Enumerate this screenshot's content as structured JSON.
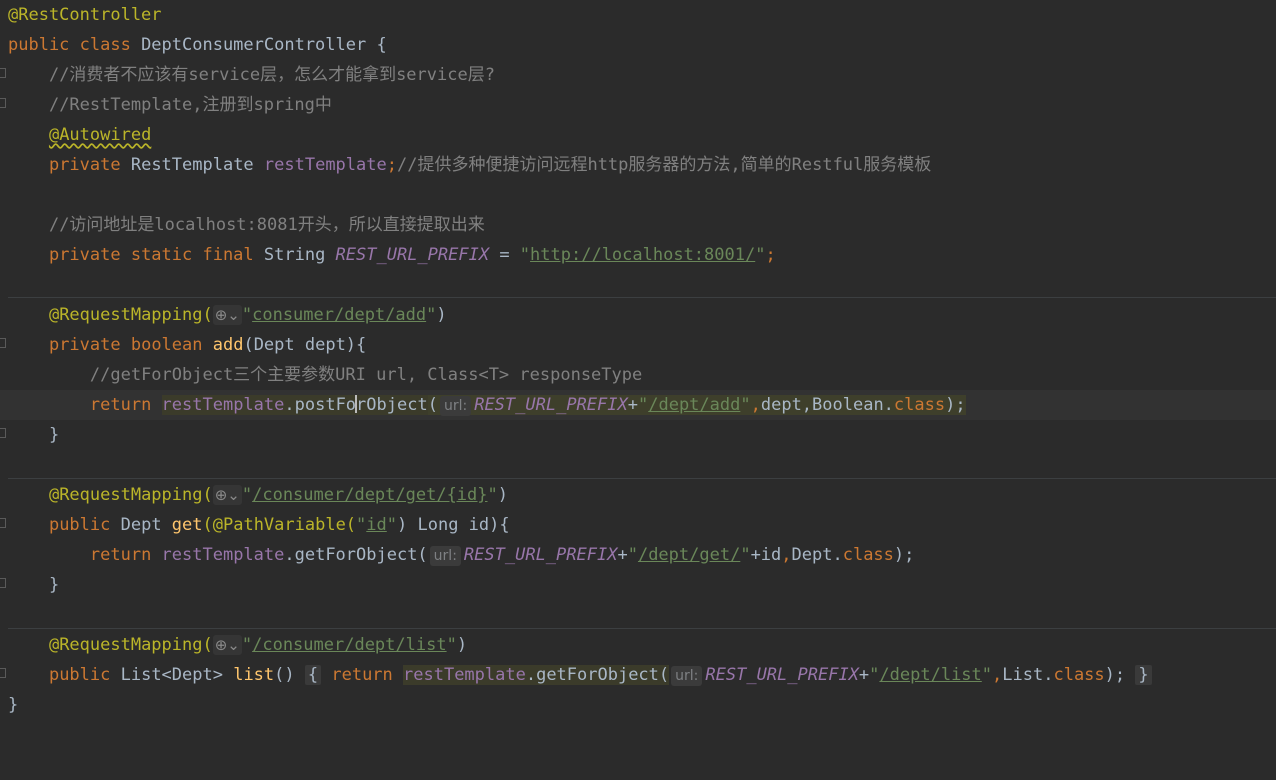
{
  "editor": {
    "line1": {
      "ann": "@RestController"
    },
    "line2": {
      "kw": "public class",
      "name": " DeptConsumerController {"
    },
    "line3": {
      "comment": "//消费者不应该有service层，怎么才能拿到service层?"
    },
    "line4": {
      "comment": "//RestTemplate,注册到spring中"
    },
    "line5": {
      "ann": "@Autowired"
    },
    "line6": {
      "kw": "private",
      "type": " RestTemplate ",
      "field": "restTemplate",
      "semi": ";",
      "comment": "//提供多种便捷访问远程http服务器的方法,简单的Restful服务模板"
    },
    "line8": {
      "comment": "//访问地址是localhost:8081开头，所以直接提取出来"
    },
    "line9": {
      "kw": "private static final",
      "type": " String ",
      "const": "REST_URL_PREFIX",
      "eq": " = ",
      "q1": "\"",
      "url": "http://localhost:8001/",
      "q2": "\"",
      "semi": ";"
    },
    "line11": {
      "ann": "@RequestMapping(",
      "glyph": "⊕⌄",
      "q1": "\"",
      "path": "consumer/dept/add",
      "q2": "\"",
      "close": ")"
    },
    "line12": {
      "kw1": "private",
      "kw2": " boolean ",
      "fn": "add",
      "rest": "(Dept dept){"
    },
    "line13": {
      "comment": "//getForObject三个主要参数URI url, Class<T> responseType"
    },
    "line14": {
      "kw": "return ",
      "obj": "restTemplate",
      "dot": ".",
      "m1": "postFo",
      "m2": "rObject",
      "paren": "(",
      "hint": "url:",
      "const": "REST_URL_PREFIX",
      "plus": "+",
      "q1": "\"",
      "path": "/dept/add",
      "q2": "\"",
      "comma": ",",
      "args": "dept,Boolean.",
      "cls": "class",
      "end": ");"
    },
    "line15": {
      "brace": "}"
    },
    "line17": {
      "ann": "@RequestMapping(",
      "glyph": "⊕⌄",
      "q1": "\"",
      "path": "/consumer/dept/get/{id}",
      "q2": "\"",
      "close": ")"
    },
    "line18": {
      "kw": "public",
      "type": " Dept ",
      "fn": "get",
      "ann2": "(@PathVariable(",
      "q1": "\"",
      "arg": "id",
      "q2": "\"",
      "rest": ") Long id){"
    },
    "line19": {
      "kw": "return ",
      "obj": "restTemplate",
      "call": ".getForObject(",
      "hint": "url:",
      "const": "REST_URL_PREFIX",
      "plus": "+",
      "q1": "\"",
      "path": "/dept/get/",
      "q2": "\"",
      "rest": "+id",
      "comma": ",",
      "args": "Dept.",
      "cls": "class",
      "end": ");"
    },
    "line20": {
      "brace": "}"
    },
    "line22": {
      "ann": "@RequestMapping(",
      "glyph": "⊕⌄",
      "q1": "\"",
      "path": "/consumer/dept/list",
      "q2": "\"",
      "close": ")"
    },
    "line23": {
      "kw": "public",
      "type": " List<Dept> ",
      "fn": "list",
      "sig": "() ",
      "ob": "{",
      "kw2": " return ",
      "obj": "restTemplate",
      "call": ".getForObject(",
      "hint": "url:",
      "const": "REST_URL_PREFIX",
      "plus": "+",
      "q1": "\"",
      "path": "/dept/list",
      "q2": "\"",
      "comma": ",",
      "args": "List.",
      "cls": "class",
      "end": ");",
      "cb": "}"
    },
    "line24": {
      "brace": "}"
    }
  }
}
